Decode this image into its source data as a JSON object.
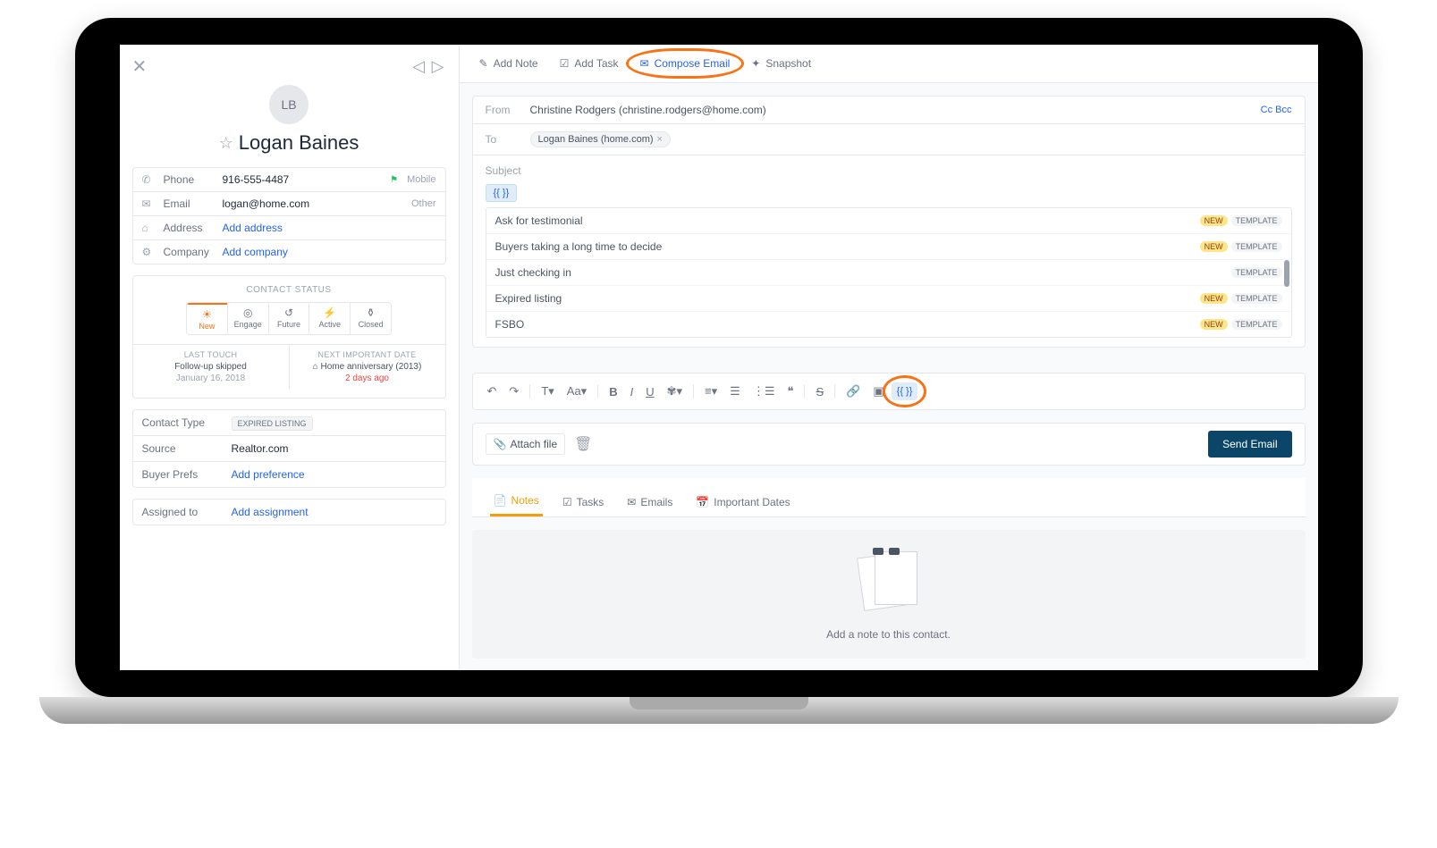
{
  "contact": {
    "initials": "LB",
    "name": "Logan Baines",
    "phone": {
      "label": "Phone",
      "value": "916-555-4487",
      "type": "Mobile"
    },
    "email": {
      "label": "Email",
      "value": "logan@home.com",
      "type": "Other"
    },
    "address": {
      "label": "Address",
      "value": "Add address"
    },
    "company": {
      "label": "Company",
      "value": "Add company"
    }
  },
  "status": {
    "title": "CONTACT STATUS",
    "options": [
      {
        "label": "New"
      },
      {
        "label": "Engage"
      },
      {
        "label": "Future"
      },
      {
        "label": "Active"
      },
      {
        "label": "Closed"
      }
    ],
    "last_touch": {
      "heading": "LAST TOUCH",
      "value": "Follow-up skipped",
      "date": "January 16, 2018"
    },
    "next_date": {
      "heading": "NEXT IMPORTANT DATE",
      "value": "Home anniversary (2013)",
      "date": "2 days ago"
    }
  },
  "details": {
    "contact_type": {
      "label": "Contact Type",
      "value": "EXPIRED LISTING"
    },
    "source": {
      "label": "Source",
      "value": "Realtor.com"
    },
    "buyer_prefs": {
      "label": "Buyer Prefs",
      "value": "Add preference"
    },
    "assigned_to": {
      "label": "Assigned to",
      "value": "Add assignment"
    }
  },
  "actions": {
    "add_note": "Add Note",
    "add_task": "Add Task",
    "compose_email": "Compose Email",
    "snapshot": "Snapshot"
  },
  "email": {
    "from_label": "From",
    "from_value": "Christine Rodgers (christine.rodgers@home.com)",
    "cc": "Cc",
    "bcc": "Bcc",
    "to_label": "To",
    "to_chip": "Logan Baines (home.com)",
    "subject_placeholder": "Subject",
    "merge_symbol": "{{  }}",
    "templates": [
      {
        "name": "Ask for testimonial",
        "new": true
      },
      {
        "name": "Buyers taking a long time to decide",
        "new": true
      },
      {
        "name": "Just checking in",
        "new": false
      },
      {
        "name": "Expired listing",
        "new": true
      },
      {
        "name": "FSBO",
        "new": true
      }
    ],
    "template_badge": "TEMPLATE",
    "new_badge": "NEW",
    "attach": "Attach file",
    "send": "Send Email"
  },
  "tabs": {
    "notes": "Notes",
    "tasks": "Tasks",
    "emails": "Emails",
    "important_dates": "Important Dates",
    "empty_text": "Add a note to this contact."
  }
}
